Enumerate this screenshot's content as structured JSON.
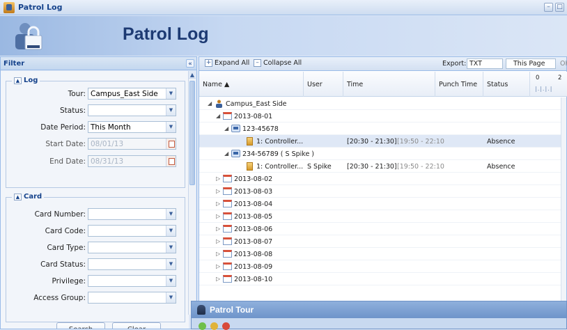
{
  "window": {
    "title": "Patrol Log"
  },
  "banner": {
    "heading": "Patrol Log"
  },
  "filter": {
    "header": "Filter",
    "collapse_icon": "«",
    "log_section": {
      "legend": "Log",
      "tour_label": "Tour:",
      "tour_value": "Campus_East Side",
      "status_label": "Status:",
      "status_value": "",
      "date_period_label": "Date Period:",
      "date_period_value": "This Month",
      "start_date_label": "Start Date:",
      "start_date_value": "08/01/13",
      "end_date_label": "End Date:",
      "end_date_value": "08/31/13"
    },
    "card_section": {
      "legend": "Card",
      "card_number_label": "Card Number:",
      "card_code_label": "Card Code:",
      "card_type_label": "Card Type:",
      "card_status_label": "Card Status:",
      "privilege_label": "Privilege:",
      "access_group_label": "Access Group:"
    },
    "search_button": "Search",
    "clear_button": "Clear"
  },
  "grid": {
    "toolbar": {
      "expand_all": "Expand All",
      "collapse_all": "Collapse All",
      "export_label": "Export:",
      "export_format": "TXT",
      "export_scope": "This Page",
      "ok_label": "OK"
    },
    "columns": {
      "name": "Name ▲",
      "user": "User",
      "time": "Time",
      "punch_time": "Punch Time",
      "status": "Status",
      "timeline_top": "0",
      "timeline_top2": "2"
    },
    "rows": [
      {
        "name": "Campus_East Side",
        "user": "",
        "time": "",
        "time_extra": "",
        "status": ""
      },
      {
        "name": "2013-08-01",
        "user": "",
        "time": "",
        "time_extra": "",
        "status": ""
      },
      {
        "name": "123-45678",
        "user": "",
        "time": "",
        "time_extra": "",
        "status": ""
      },
      {
        "name": "1: Controller...",
        "user": "",
        "time": "[20:30 - 21:30]",
        "time_extra": "[19:50 - 22:10",
        "status": "Absence"
      },
      {
        "name": "234-56789 ( S Spike )",
        "user": "",
        "time": "",
        "time_extra": "",
        "status": ""
      },
      {
        "name": "1: Controller...",
        "user": "S Spike",
        "time": "[20:30 - 21:30]",
        "time_extra": "[19:50 - 22:10",
        "status": "Absence"
      },
      {
        "name": "2013-08-02"
      },
      {
        "name": "2013-08-03"
      },
      {
        "name": "2013-08-04"
      },
      {
        "name": "2013-08-05"
      },
      {
        "name": "2013-08-06"
      },
      {
        "name": "2013-08-07"
      },
      {
        "name": "2013-08-08"
      },
      {
        "name": "2013-08-09"
      },
      {
        "name": "2013-08-10"
      }
    ]
  },
  "tour_window": {
    "title": "Patrol Tour"
  },
  "colors": {
    "accent": "#15428b",
    "heading": "#1d3a73",
    "absence": "#b83a2a",
    "tour_bar": "#6e94ca"
  }
}
